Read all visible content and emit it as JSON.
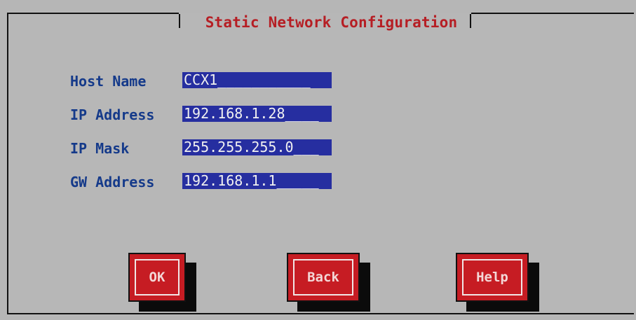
{
  "dialog": {
    "title": "Static Network Configuration"
  },
  "form": {
    "fields": [
      {
        "label": "Host Name",
        "value": "CCX1___________"
      },
      {
        "label": "IP Address",
        "value": "192.168.1.28____"
      },
      {
        "label": "IP Mask",
        "value": "255.255.255.0___"
      },
      {
        "label": "GW Address",
        "value": "192.168.1.1_____"
      }
    ]
  },
  "buttons": {
    "ok": "OK",
    "back": "Back",
    "help": "Help"
  },
  "colors": {
    "background": "#b6b6b6",
    "title": "#b61e24",
    "label": "#153a8a",
    "field_bg": "#262ea0",
    "button_bg": "#c61c23"
  }
}
